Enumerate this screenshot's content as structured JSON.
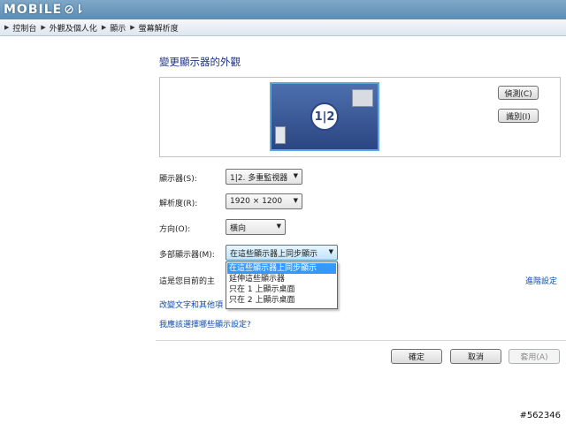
{
  "branding": {
    "logo_text": "MOBILE",
    "logo_mark": "⊘⇂"
  },
  "breadcrumb": {
    "items": [
      {
        "label": "控制台"
      },
      {
        "label": "外觀及個人化"
      },
      {
        "label": "顯示"
      },
      {
        "label": "螢幕解析度"
      }
    ]
  },
  "page": {
    "title": "變更顯示器的外觀"
  },
  "preview": {
    "monitor_label": "1|2",
    "detect_label": "偵測(C)",
    "identify_label": "識別(I)"
  },
  "settings": {
    "display_label": "顯示器(S):",
    "display_value": "1|2. 多重監視器",
    "resolution_label": "解析度(R):",
    "resolution_value": "1920 × 1200",
    "orientation_label": "方向(O):",
    "orientation_value": "橫向",
    "multi_label": "多部顯示器(M):",
    "multi_value": "在這些顯示器上同步顯示",
    "multi_options": [
      {
        "label": "在這些顯示器上同步顯示",
        "selected": true
      },
      {
        "label": "延伸這些顯示器",
        "selected": false
      },
      {
        "label": "只在 1 上顯示桌面",
        "selected": false
      },
      {
        "label": "只在 2 上顯示桌面",
        "selected": false
      }
    ]
  },
  "links": {
    "theme_text": "這是您目前的主",
    "advanced": "進階設定",
    "text_size": "改變文字和其他項",
    "help": "我應該選擇哪些顯示設定?"
  },
  "buttons": {
    "ok": "確定",
    "cancel": "取消",
    "apply": "套用(A)"
  },
  "watermark": "#562346",
  "colors": {
    "link": "#0b4cb4",
    "title": "#1e3287",
    "selection": "#3399ff",
    "topbar": "#5d8db3"
  }
}
